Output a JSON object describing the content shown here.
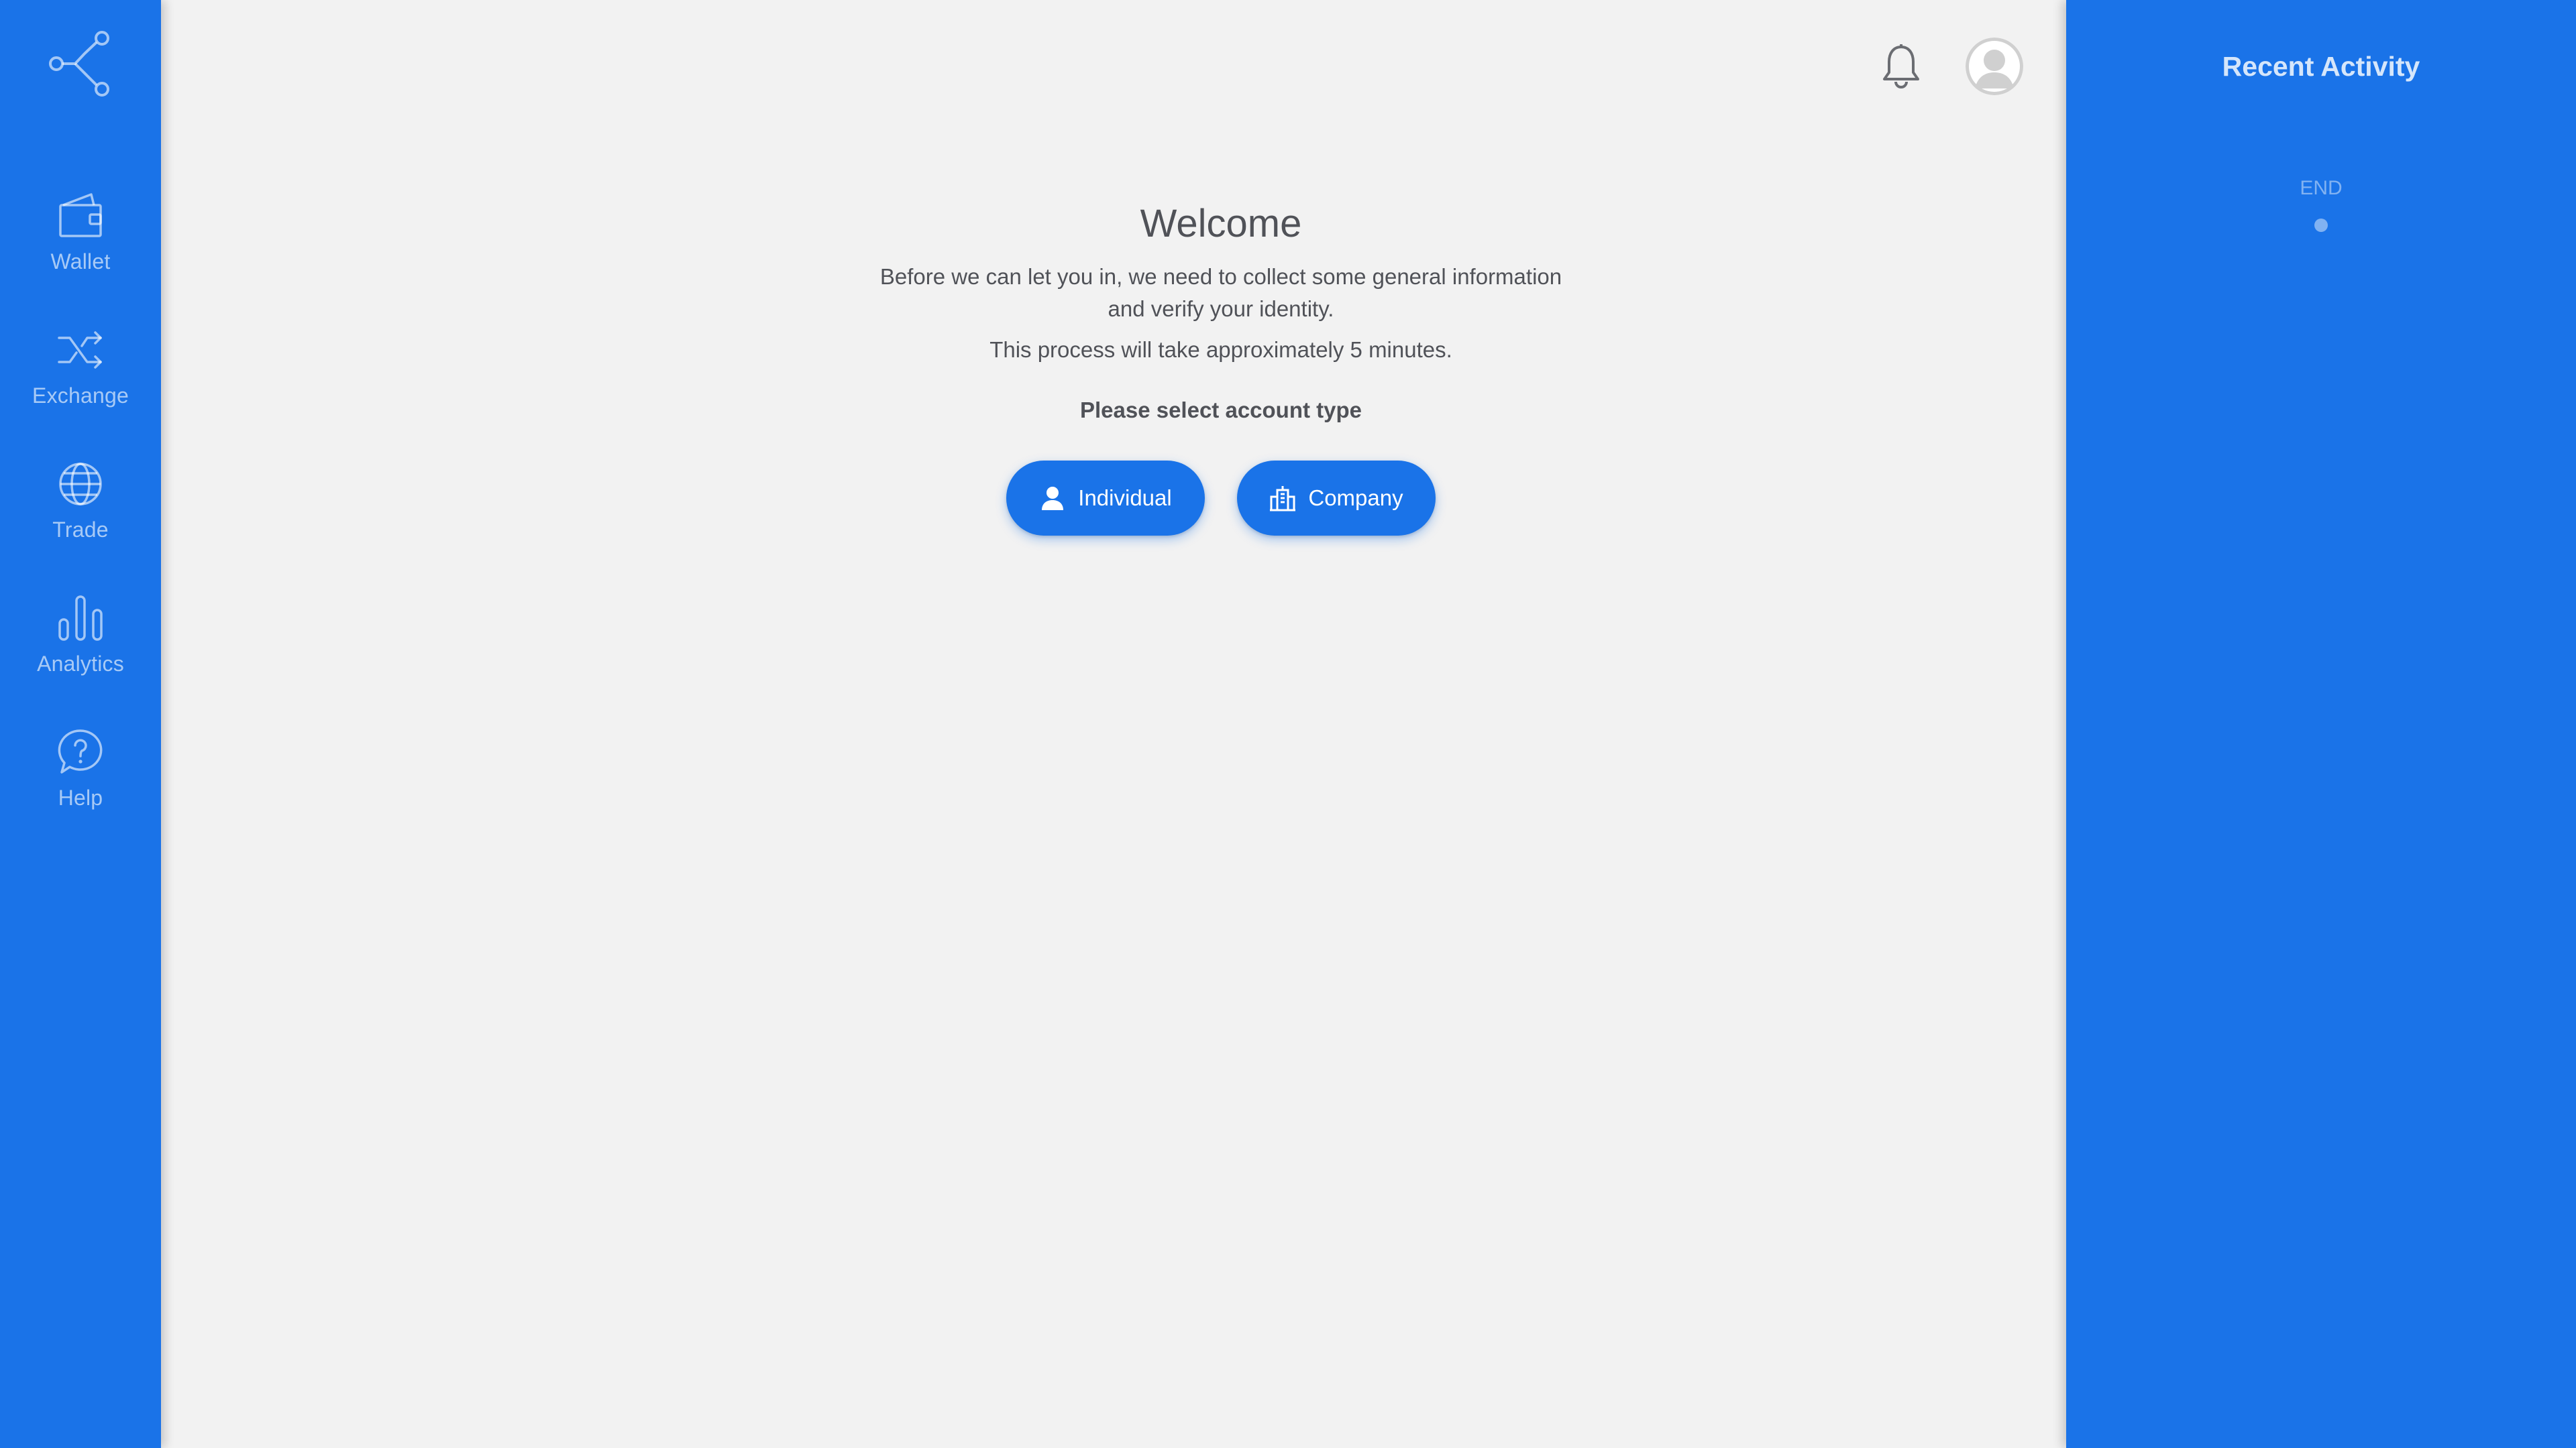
{
  "sidebar": {
    "logo_icon": "share-nodes-icon",
    "items": [
      {
        "label": "Wallet",
        "icon": "wallet-icon"
      },
      {
        "label": "Exchange",
        "icon": "shuffle-icon"
      },
      {
        "label": "Trade",
        "icon": "globe-icon"
      },
      {
        "label": "Analytics",
        "icon": "bar-chart-icon"
      },
      {
        "label": "Help",
        "icon": "help-bubble-icon"
      }
    ]
  },
  "header": {
    "notification_icon": "bell-icon",
    "avatar_icon": "user-avatar-icon"
  },
  "main": {
    "title": "Welcome",
    "intro": "Before we can let you in, we need to collect some general information and verify your identity.",
    "duration_note": "This process will take approximately 5 minutes.",
    "select_prompt": "Please select account type",
    "buttons": {
      "individual": {
        "label": "Individual",
        "icon": "person-icon"
      },
      "company": {
        "label": "Company",
        "icon": "building-icon"
      }
    }
  },
  "recent_activity": {
    "title": "Recent Activity",
    "end_label": "END"
  },
  "colors": {
    "primary": "#1a73e8",
    "background": "#f2f2f2",
    "text": "#505258"
  }
}
